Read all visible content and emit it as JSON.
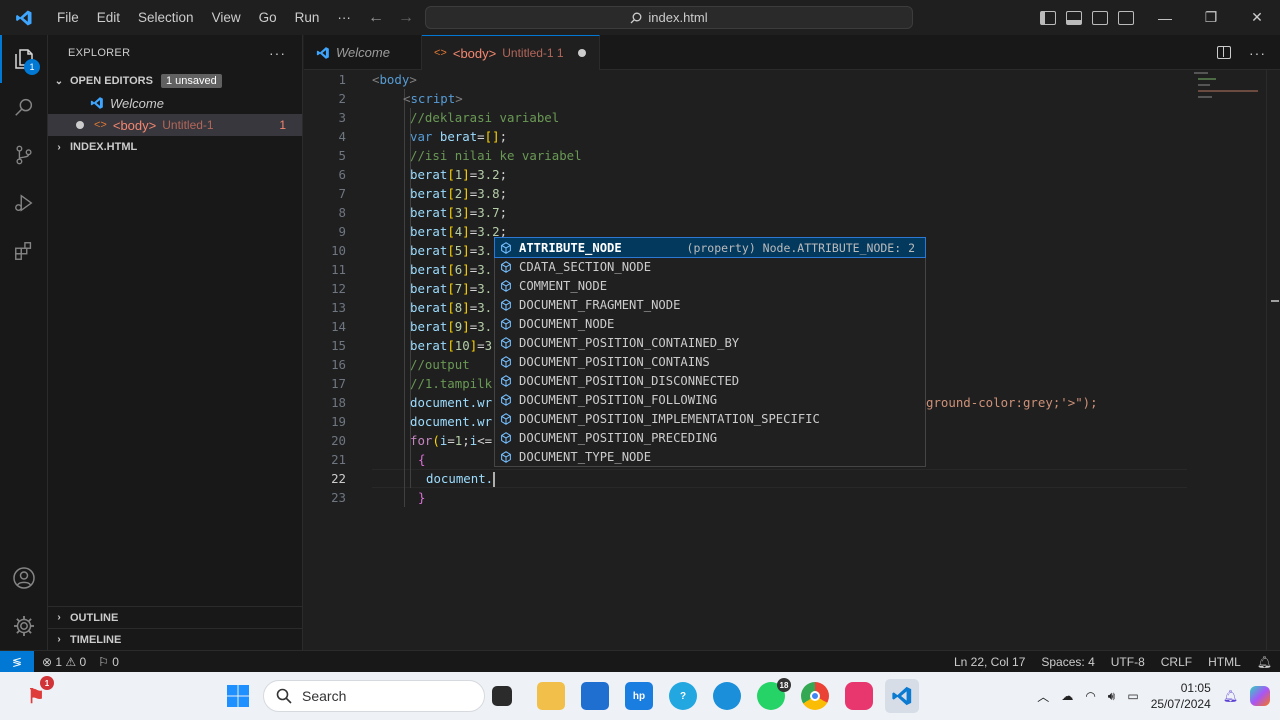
{
  "menu": {
    "items": [
      "File",
      "Edit",
      "Selection",
      "View",
      "Go",
      "Run",
      "···"
    ]
  },
  "command_center": {
    "text": "index.html"
  },
  "activity_bar": {
    "explorer_badge": "1"
  },
  "explorer": {
    "title": "EXPLORER",
    "open_editors_label": "OPEN EDITORS",
    "unsaved_label": "1 unsaved",
    "items": [
      {
        "name": "Welcome"
      },
      {
        "name": "<body>",
        "detail": "Untitled-1",
        "count": "1"
      }
    ],
    "folder_label": "INDEX.HTML",
    "outline_label": "OUTLINE",
    "timeline_label": "TIMELINE"
  },
  "tabs": [
    {
      "label": "Welcome"
    },
    {
      "label": "<body>",
      "detail": "Untitled-1 1"
    }
  ],
  "editor": {
    "current_line": 22,
    "lines": [
      {
        "n": "1",
        "text": "<body>"
      },
      {
        "n": "2",
        "text": "<script>"
      },
      {
        "n": "3",
        "text": "//deklarasi variabel"
      },
      {
        "n": "4",
        "text": "var berat=[];"
      },
      {
        "n": "5",
        "text": "//isi nilai ke variabel"
      },
      {
        "n": "6",
        "text": "berat[1]=3.2;"
      },
      {
        "n": "7",
        "text": "berat[2]=3.8;"
      },
      {
        "n": "8",
        "text": "berat[3]=3.7;"
      },
      {
        "n": "9",
        "text": "berat[4]=3.2;"
      },
      {
        "n": "10",
        "text": "berat[5]=3."
      },
      {
        "n": "11",
        "text": "berat[6]=3."
      },
      {
        "n": "12",
        "text": "berat[7]=3."
      },
      {
        "n": "13",
        "text": "berat[8]=3."
      },
      {
        "n": "14",
        "text": "berat[9]=3."
      },
      {
        "n": "15",
        "text": "berat[10]=3"
      },
      {
        "n": "16",
        "text": "//output"
      },
      {
        "n": "17",
        "text": "//1.tampilk"
      },
      {
        "n": "18",
        "text": "document.wr",
        "tail": "ground-color:grey;'>\");"
      },
      {
        "n": "19",
        "text": "document.wr"
      },
      {
        "n": "20",
        "text": "for(i=1;i<="
      },
      {
        "n": "21",
        "text": "{"
      },
      {
        "n": "22",
        "text": "document."
      },
      {
        "n": "23",
        "text": "}"
      }
    ]
  },
  "suggest": {
    "items": [
      {
        "label": "ATTRIBUTE_NODE",
        "detail": "(property) Node.ATTRIBUTE_NODE: 2"
      },
      {
        "label": "CDATA_SECTION_NODE"
      },
      {
        "label": "COMMENT_NODE"
      },
      {
        "label": "DOCUMENT_FRAGMENT_NODE"
      },
      {
        "label": "DOCUMENT_NODE"
      },
      {
        "label": "DOCUMENT_POSITION_CONTAINED_BY"
      },
      {
        "label": "DOCUMENT_POSITION_CONTAINS"
      },
      {
        "label": "DOCUMENT_POSITION_DISCONNECTED"
      },
      {
        "label": "DOCUMENT_POSITION_FOLLOWING"
      },
      {
        "label": "DOCUMENT_POSITION_IMPLEMENTATION_SPECIFIC"
      },
      {
        "label": "DOCUMENT_POSITION_PRECEDING"
      },
      {
        "label": "DOCUMENT_TYPE_NODE"
      }
    ]
  },
  "status_bar": {
    "problems": "⊗ 1 ⚠ 0",
    "ports": "⚐ 0",
    "position": "Ln 22, Col 17",
    "spaces": "Spaces: 4",
    "encoding": "UTF-8",
    "eol": "CRLF",
    "language": "HTML"
  },
  "taskbar": {
    "search_placeholder": "Search",
    "whatsapp_badge": "18",
    "notif_badge": "1",
    "time": "01:05",
    "date": "25/07/2024"
  },
  "colors": {
    "accent": "#0078d4",
    "background": "#1f1f1f",
    "sidebar": "#181818"
  }
}
